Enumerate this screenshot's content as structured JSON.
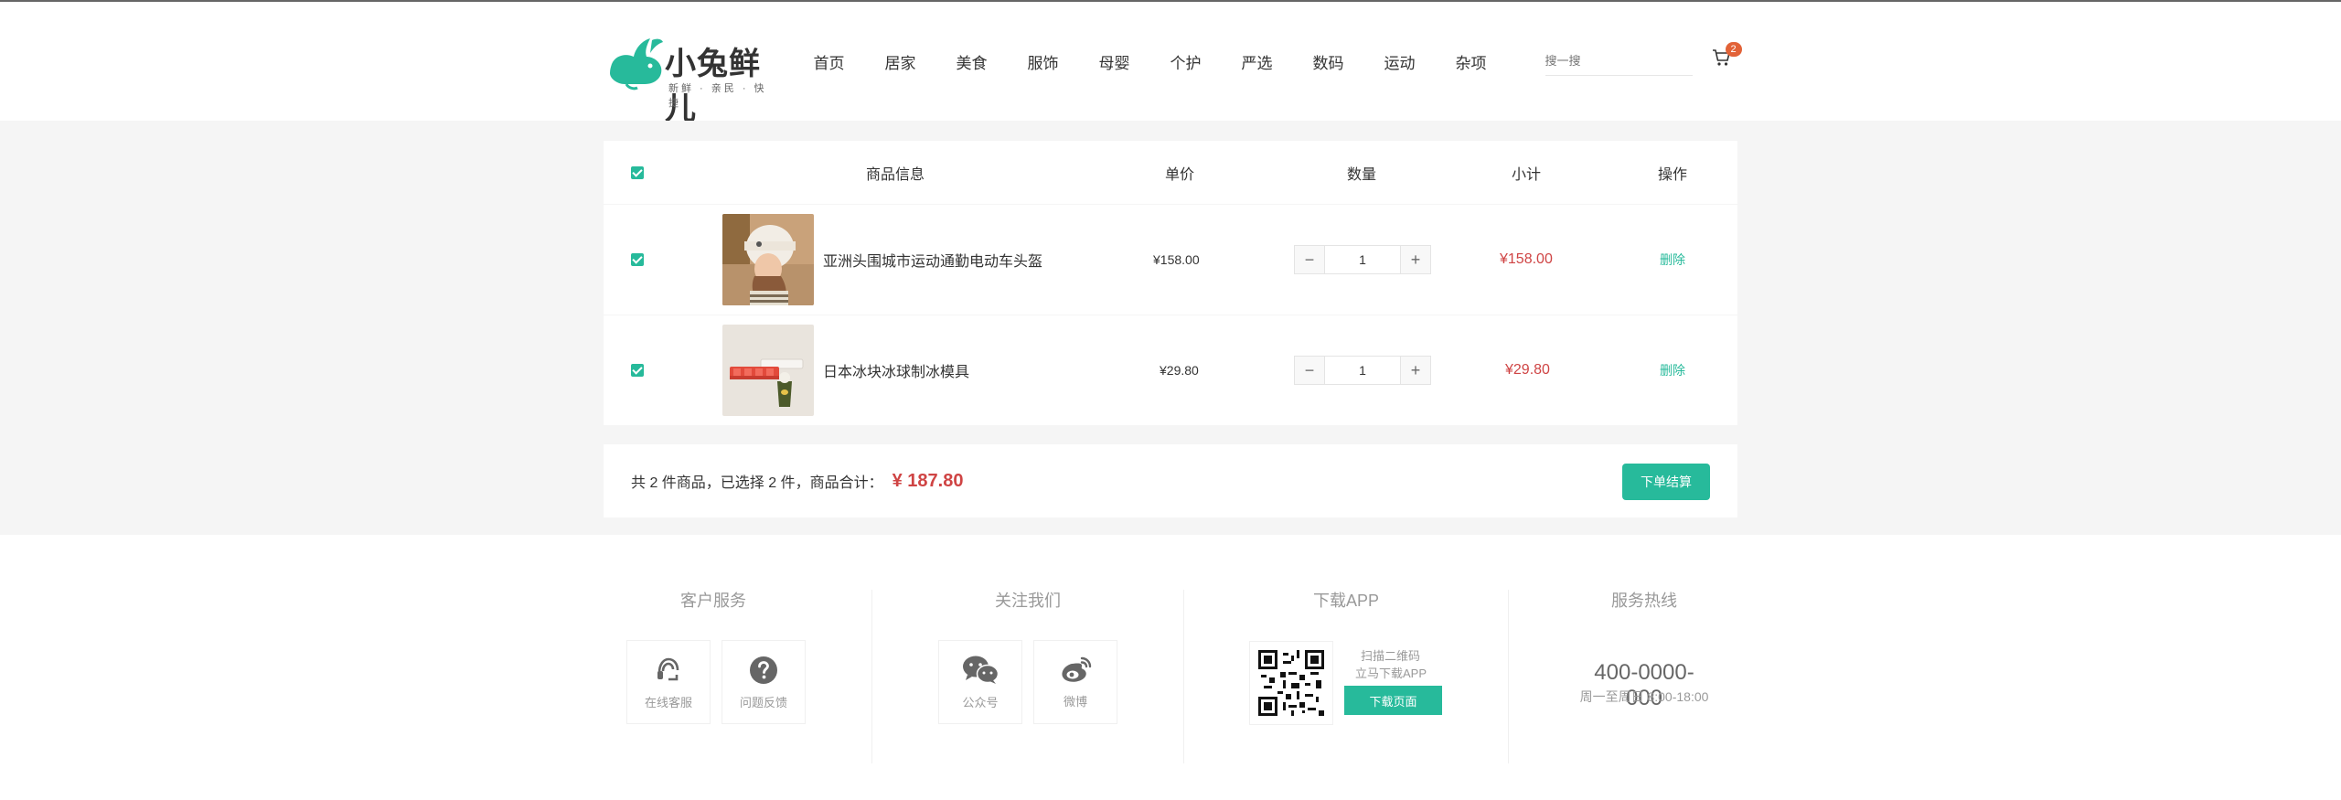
{
  "header": {
    "logo_text": "小兔鲜儿",
    "logo_slogan": "新鲜 · 亲民 · 快捷",
    "nav": [
      "首页",
      "居家",
      "美食",
      "服饰",
      "母婴",
      "个护",
      "严选",
      "数码",
      "运动",
      "杂项"
    ],
    "search_placeholder": "搜一搜",
    "cart_count": "2"
  },
  "table": {
    "headers": {
      "info": "商品信息",
      "price": "单价",
      "qty": "数量",
      "subtotal": "小计",
      "action": "操作"
    },
    "items": [
      {
        "name": "亚洲头围城市运动通勤电动车头盔",
        "price": "¥158.00",
        "qty": "1",
        "subtotal": "¥158.00",
        "action": "删除"
      },
      {
        "name": "日本冰块冰球制冰模具",
        "price": "¥29.80",
        "qty": "1",
        "subtotal": "¥29.80",
        "action": "删除"
      }
    ]
  },
  "summary": {
    "text": "共 2 件商品，已选择 2 件，商品合计：",
    "total": "¥ 187.80",
    "checkout_label": "下单结算"
  },
  "footer": {
    "service_title": "客户服务",
    "online_service": "在线客服",
    "feedback": "问题反馈",
    "follow_title": "关注我们",
    "wechat": "公众号",
    "weibo": "微博",
    "app_title": "下载APP",
    "scan_tip": "扫描二维码",
    "download_tip": "立马下载APP",
    "download_button": "下载页面",
    "hotline_title": "服务热线",
    "hotline": "400-0000-000",
    "hours": "周一至周日 8:00-18:00"
  },
  "colors": {
    "accent": "#27ba9b",
    "price_red": "#cf4444",
    "badge": "#e26237"
  }
}
